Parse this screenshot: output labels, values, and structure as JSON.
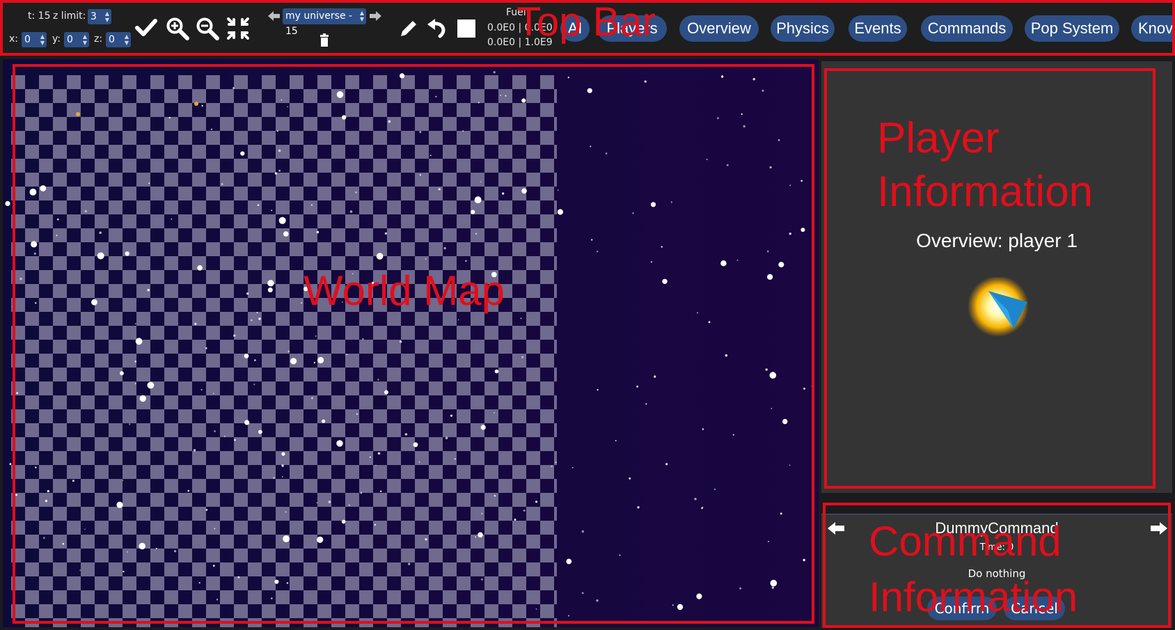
{
  "topbar": {
    "t_label": "t: 15",
    "zlimit_label": "z limit:",
    "zlimit_value": "3",
    "x_label": "x:",
    "x_value": "0",
    "y_label": "y:",
    "y_value": "0",
    "z_label": "z:",
    "z_value": "0",
    "universe_select": "my universe - 15",
    "fuel_label": "Fuel",
    "fuel_line1": "0.0E0 | 0.0E0",
    "fuel_line2": "0.0E0 | 1.0E9",
    "icons": [
      "check-icon",
      "zoom-in-icon",
      "zoom-out-icon",
      "fit-screen-icon",
      "arrow-left-icon",
      "arrow-right-icon",
      "trash-icon",
      "pencil-icon",
      "undo-icon",
      "stop-icon"
    ],
    "nav": [
      {
        "label": "AI"
      },
      {
        "label": "Players"
      },
      {
        "label": "Overview"
      },
      {
        "label": "Physics"
      },
      {
        "label": "Events"
      },
      {
        "label": "Commands"
      },
      {
        "label": "Pop System"
      },
      {
        "label": "Knov"
      }
    ]
  },
  "annotations": {
    "top_bar": "Top Bar",
    "world_map": "World Map",
    "player_info_1": "Player",
    "player_info_2": "Information",
    "command_info_1": "Command",
    "command_info_2": "Information"
  },
  "player_panel": {
    "title": "Overview: player 1",
    "icon": "player-emblem-icon"
  },
  "command_panel": {
    "command_name": "DummyCommand",
    "time_label": "Time: 0",
    "description": "Do nothing",
    "confirm_label": "Confirm",
    "cancel_label": "Cancel"
  },
  "colors": {
    "annotation_red": "#e00f1c",
    "button_blue": "#2d4f86",
    "map_bg": "#14093a",
    "panel_bg": "#343434",
    "checker": "#6f6a8e"
  }
}
